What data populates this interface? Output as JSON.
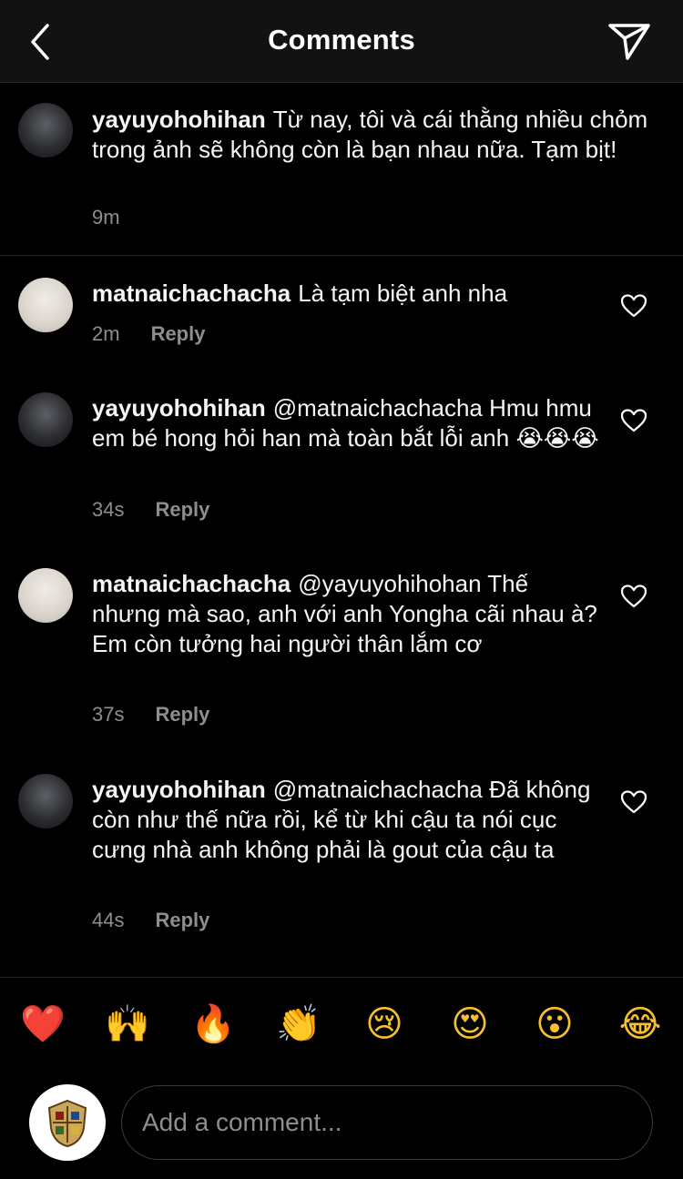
{
  "header": {
    "title": "Comments"
  },
  "caption": {
    "username": "yayuyohohihan",
    "text": "Từ nay, tôi và cái thằng nhiều chỏm trong ảnh sẽ không còn là bạn nhau nữa. Tạm bịt!",
    "time": "9m"
  },
  "comments": [
    {
      "username": "matnaichachacha",
      "text": "Là tạm biệt anh nha",
      "time": "2m",
      "reply": "Reply"
    },
    {
      "username": "yayuyohohihan",
      "text": "@matnaichachacha Hmu hmu em bé hong hỏi han mà toàn bắt lỗi anh 😭😭😭",
      "time": "34s",
      "reply": "Reply"
    },
    {
      "username": "matnaichachacha",
      "text": "@yayuyohihohan Thế nhưng mà sao, anh với anh Yongha cãi nhau à? Em còn tưởng hai người thân lắm cơ",
      "time": "37s",
      "reply": "Reply"
    },
    {
      "username": "yayuyohohihan",
      "text": "@matnaichachacha Đã không còn như thế nữa rồi, kể từ khi cậu ta nói cục cưng nhà anh không phải là gout của cậu ta",
      "time": "44s",
      "reply": "Reply"
    }
  ],
  "emojis": [
    "❤️",
    "🙌",
    "🔥",
    "👏",
    "😢",
    "😍",
    "😮",
    "😂"
  ],
  "composer": {
    "placeholder": "Add a comment..."
  },
  "colors": {
    "background": "#000000",
    "header": "#121212",
    "muted": "#8e8e8e",
    "divider": "#262626"
  }
}
